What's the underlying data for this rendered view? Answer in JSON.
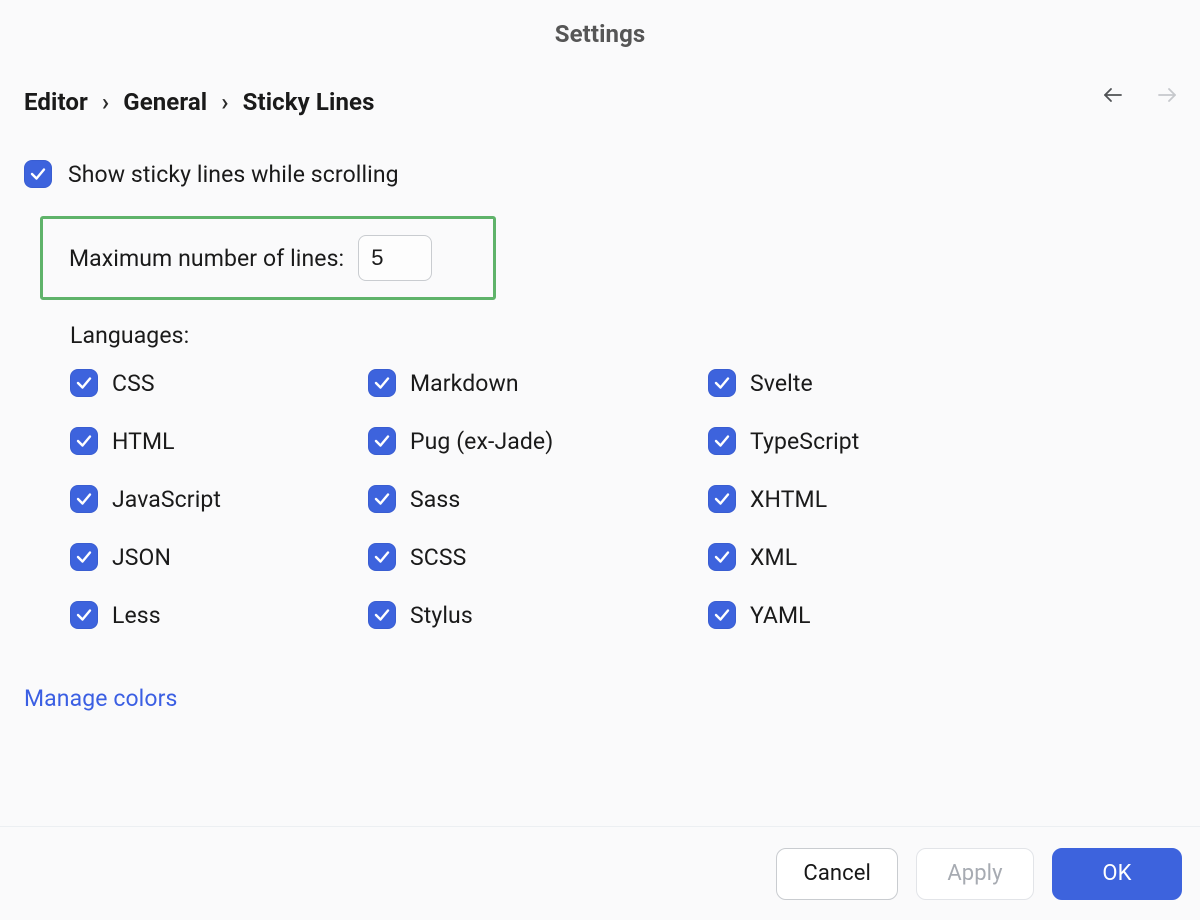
{
  "title": "Settings",
  "breadcrumb": {
    "item1": "Editor",
    "item2": "General",
    "item3": "Sticky Lines",
    "sep": "›"
  },
  "show_sticky": {
    "checked": true,
    "label": "Show sticky lines while scrolling"
  },
  "max_lines": {
    "label": "Maximum number of lines:",
    "value": "5"
  },
  "languages_label": "Languages:",
  "languages": {
    "col1": [
      {
        "label": "CSS",
        "checked": true
      },
      {
        "label": "HTML",
        "checked": true
      },
      {
        "label": "JavaScript",
        "checked": true
      },
      {
        "label": "JSON",
        "checked": true
      },
      {
        "label": "Less",
        "checked": true
      }
    ],
    "col2": [
      {
        "label": "Markdown",
        "checked": true
      },
      {
        "label": "Pug (ex-Jade)",
        "checked": true
      },
      {
        "label": "Sass",
        "checked": true
      },
      {
        "label": "SCSS",
        "checked": true
      },
      {
        "label": "Stylus",
        "checked": true
      }
    ],
    "col3": [
      {
        "label": "Svelte",
        "checked": true
      },
      {
        "label": "TypeScript",
        "checked": true
      },
      {
        "label": "XHTML",
        "checked": true
      },
      {
        "label": "XML",
        "checked": true
      },
      {
        "label": "YAML",
        "checked": true
      }
    ]
  },
  "manage_colors": "Manage colors",
  "buttons": {
    "cancel": "Cancel",
    "apply": "Apply",
    "ok": "OK"
  },
  "colors": {
    "accent": "#3d63dd",
    "highlight": "#5fb36a",
    "link": "#3b5fe3"
  }
}
